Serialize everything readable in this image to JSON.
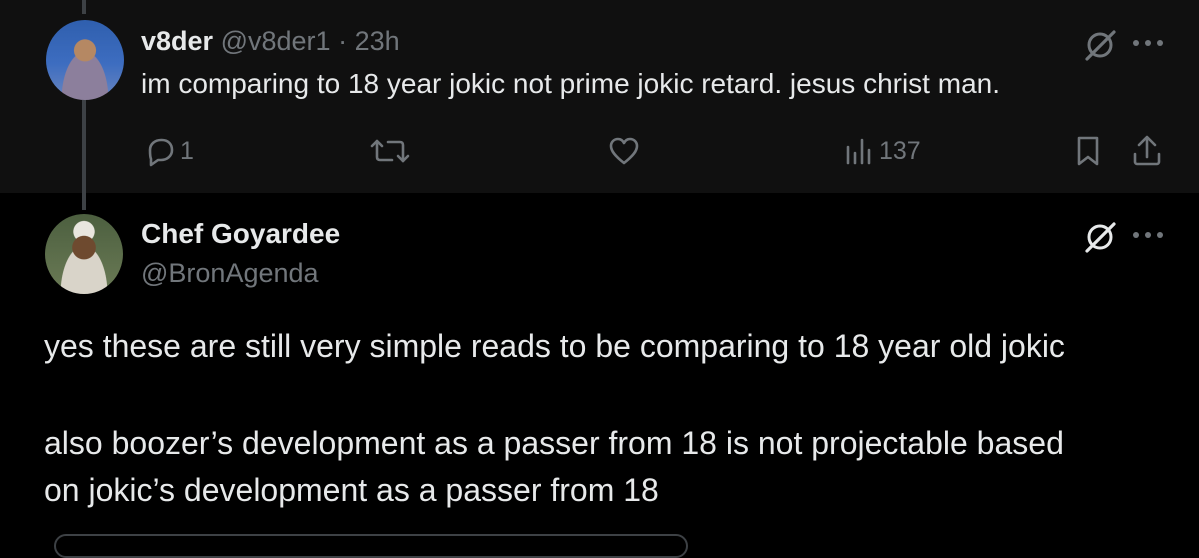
{
  "reply": {
    "display_name": "v8der",
    "handle": "@v8der1",
    "separator": "·",
    "timestamp": "23h",
    "text": "im comparing to 18 year jokic not prime jokic retard. jesus christ man.",
    "actions": {
      "reply_count": "1",
      "view_count": "137"
    },
    "icons": [
      "grok-icon",
      "more-icon",
      "reply-icon",
      "repost-icon",
      "like-icon",
      "views-icon",
      "bookmark-icon",
      "share-icon"
    ]
  },
  "main": {
    "display_name": "Chef Goyardee",
    "handle": "@BronAgenda",
    "text_lines": [
      "yes these are still very simple reads to be comparing to 18 year old jokic",
      "also boozer’s development as a passer from 18 is not projectable based",
      "on jokic’s development as a passer from 18"
    ]
  },
  "colors": {
    "background": "#000000",
    "reply_background": "#101010",
    "primary_text": "#e7e9ea",
    "secondary_text": "#71767b",
    "thread_line": "#3d4145"
  }
}
